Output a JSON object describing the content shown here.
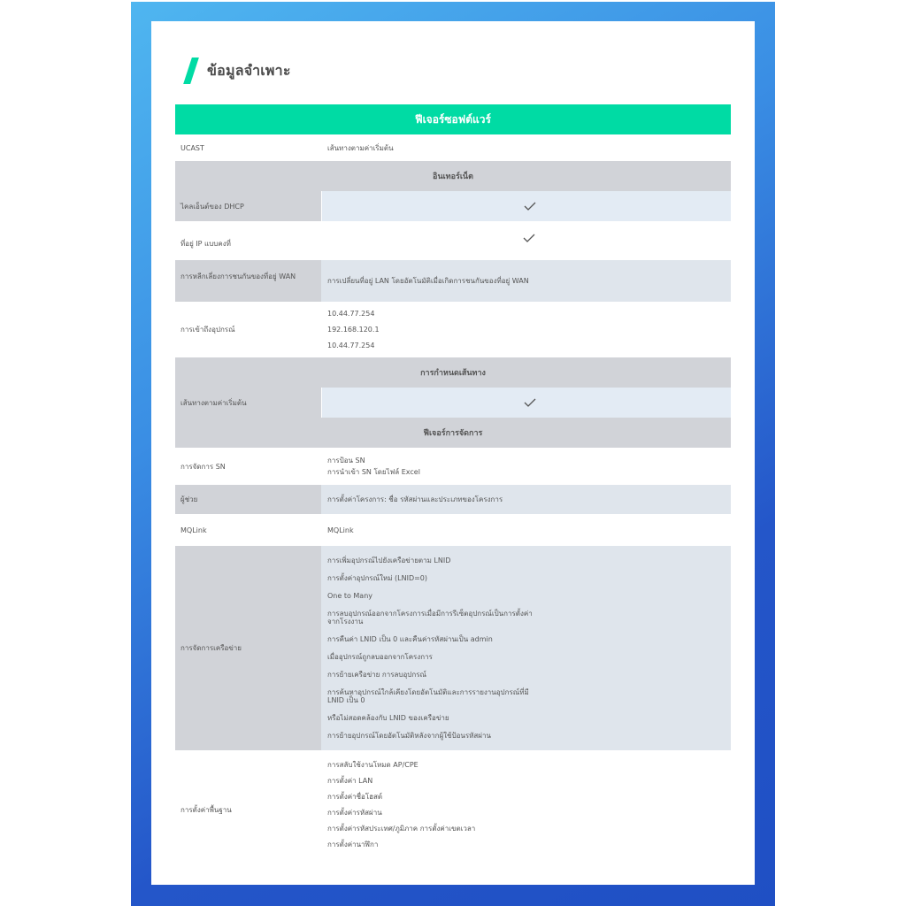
{
  "heading": "ข้อมูลจำเพาะ",
  "table_title": "ฟีเจอร์ซอฟต์แวร์",
  "rows": {
    "ucast": {
      "label": "UCAST",
      "value": "เส้นทางตามค่าเริ่มต้น"
    },
    "sec_internet": "อินเทอร์เน็ต",
    "dhcp": {
      "label": "ไคลเอ็นต์ของ DHCP"
    },
    "static_ip": {
      "label": "ที่อยู่ IP แบบคงที่"
    },
    "wan_conflict": {
      "label": "การหลีกเลี่ยงการชนกันของที่อยู่ WAN",
      "value": "การเปลี่ยนที่อยู่ LAN โดยอัตโนมัติเมื่อเกิดการชนกันของที่อยู่ WAN"
    },
    "device_access": {
      "label": "การเข้าถึงอุปกรณ์",
      "values": [
        "10.44.77.254",
        "192.168.120.1",
        "10.44.77.254"
      ]
    },
    "sec_routing": "การกำหนดเส้นทาง",
    "default_route": {
      "label": "เส้นทางตามค่าเริ่มต้น"
    },
    "sec_management": "ฟีเจอร์การจัดการ",
    "sn_management": {
      "label": "การจัดการ SN",
      "values": [
        "การป้อน SN",
        "การนำเข้า SN โดยไฟล์ Excel"
      ]
    },
    "assistant": {
      "label": "ผู้ช่วย",
      "value": "การตั้งค่าโครงการ: ชื่อ รหัสผ่านและประเภทของโครงการ"
    },
    "mqlink": {
      "label": "MQLink",
      "value": "MQLink"
    },
    "network_management": {
      "label": "การจัดการเครือข่าย",
      "values": [
        "การเพิ่มอุปกรณ์ไปยังเครือข่ายตาม LNID",
        "การตั้งค่าอุปกรณ์ใหม่ (LNID=0)",
        "One to Many",
        "การลบอุปกรณ์ออกจากโครงการเมื่อมีการรีเซ็ตอุปกรณ์เป็นการตั้งค่า\nจากโรงงาน",
        "การคืนค่า LNID เป็น 0 และคืนค่ารหัสผ่านเป็น admin",
        "เมื่ออุปกรณ์ถูกลบออกจากโครงการ",
        "การย้ายเครือข่าย การลบอุปกรณ์",
        "การค้นหาอุปกรณ์ใกล้เคียงโดยอัตโนมัติและการรายงานอุปกรณ์ที่มี\nLNID เป็น 0",
        "หรือไม่สอดคล้องกับ LNID ของเครือข่าย",
        "การย้ายอุปกรณ์โดยอัตโนมัติหลังจากผู้ใช้ป้อนรหัสผ่าน"
      ]
    },
    "basic_settings": {
      "label": "การตั้งค่าพื้นฐาน",
      "values": [
        "การสลับใช้งานโหมด AP/CPE",
        "การตั้งค่า LAN",
        "การตั้งค่าชื่อโฮสต์",
        "การตั้งค่ารหัสผ่าน",
        "การตั้งค่ารหัสประเทศ/ภูมิภาค การตั้งค่าเขตเวลา",
        "การตั้งค่านาฬิกา"
      ]
    }
  },
  "colors": {
    "accent": "#00dba4",
    "section": "#d1d3d8",
    "shade": "#dfe5ec",
    "frame": "#2456c9"
  },
  "icons": {
    "check": "check-icon"
  }
}
